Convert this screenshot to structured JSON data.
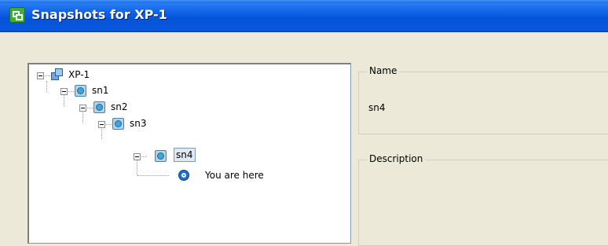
{
  "window": {
    "title": "Snapshots for XP-1"
  },
  "tree": {
    "root": "XP-1",
    "snapshots": [
      "sn1",
      "sn2",
      "sn3",
      "sn4"
    ],
    "selected": "sn4",
    "current_position_label": "You are here"
  },
  "details": {
    "name_label": "Name",
    "name_value": "sn4",
    "description_label": "Description",
    "description_value": ""
  }
}
